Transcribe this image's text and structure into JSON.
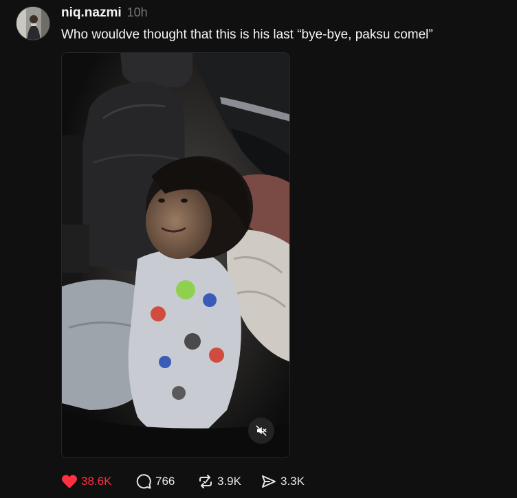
{
  "post": {
    "username": "niq.nazmi",
    "timestamp": "10h",
    "caption": "Who wouldve thought that this is his last “bye-bye, paksu comel”",
    "media": {
      "type": "video",
      "muted": true
    },
    "actions": {
      "likes": "38.6K",
      "liked": true,
      "replies": "766",
      "reposts": "3.9K",
      "shares": "3.3K"
    }
  },
  "colors": {
    "background": "#101010",
    "text_primary": "#f3f5f7",
    "text_secondary": "#777777",
    "like_accent": "#ff3040"
  },
  "icons": {
    "like": "heart-filled-icon",
    "reply": "comment-icon",
    "repost": "repost-icon",
    "share": "send-icon",
    "mute": "speaker-muted-icon"
  }
}
